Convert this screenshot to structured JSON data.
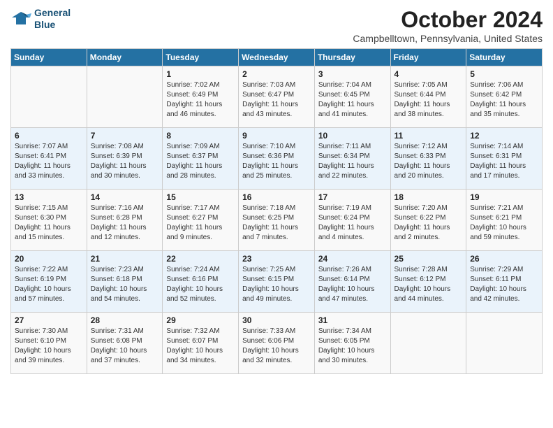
{
  "logo": {
    "line1": "General",
    "line2": "Blue"
  },
  "title": "October 2024",
  "subtitle": "Campbelltown, Pennsylvania, United States",
  "days_of_week": [
    "Sunday",
    "Monday",
    "Tuesday",
    "Wednesday",
    "Thursday",
    "Friday",
    "Saturday"
  ],
  "weeks": [
    [
      {
        "day": "",
        "sunrise": "",
        "sunset": "",
        "daylight": ""
      },
      {
        "day": "",
        "sunrise": "",
        "sunset": "",
        "daylight": ""
      },
      {
        "day": "1",
        "sunrise": "Sunrise: 7:02 AM",
        "sunset": "Sunset: 6:49 PM",
        "daylight": "Daylight: 11 hours and 46 minutes."
      },
      {
        "day": "2",
        "sunrise": "Sunrise: 7:03 AM",
        "sunset": "Sunset: 6:47 PM",
        "daylight": "Daylight: 11 hours and 43 minutes."
      },
      {
        "day": "3",
        "sunrise": "Sunrise: 7:04 AM",
        "sunset": "Sunset: 6:45 PM",
        "daylight": "Daylight: 11 hours and 41 minutes."
      },
      {
        "day": "4",
        "sunrise": "Sunrise: 7:05 AM",
        "sunset": "Sunset: 6:44 PM",
        "daylight": "Daylight: 11 hours and 38 minutes."
      },
      {
        "day": "5",
        "sunrise": "Sunrise: 7:06 AM",
        "sunset": "Sunset: 6:42 PM",
        "daylight": "Daylight: 11 hours and 35 minutes."
      }
    ],
    [
      {
        "day": "6",
        "sunrise": "Sunrise: 7:07 AM",
        "sunset": "Sunset: 6:41 PM",
        "daylight": "Daylight: 11 hours and 33 minutes."
      },
      {
        "day": "7",
        "sunrise": "Sunrise: 7:08 AM",
        "sunset": "Sunset: 6:39 PM",
        "daylight": "Daylight: 11 hours and 30 minutes."
      },
      {
        "day": "8",
        "sunrise": "Sunrise: 7:09 AM",
        "sunset": "Sunset: 6:37 PM",
        "daylight": "Daylight: 11 hours and 28 minutes."
      },
      {
        "day": "9",
        "sunrise": "Sunrise: 7:10 AM",
        "sunset": "Sunset: 6:36 PM",
        "daylight": "Daylight: 11 hours and 25 minutes."
      },
      {
        "day": "10",
        "sunrise": "Sunrise: 7:11 AM",
        "sunset": "Sunset: 6:34 PM",
        "daylight": "Daylight: 11 hours and 22 minutes."
      },
      {
        "day": "11",
        "sunrise": "Sunrise: 7:12 AM",
        "sunset": "Sunset: 6:33 PM",
        "daylight": "Daylight: 11 hours and 20 minutes."
      },
      {
        "day": "12",
        "sunrise": "Sunrise: 7:14 AM",
        "sunset": "Sunset: 6:31 PM",
        "daylight": "Daylight: 11 hours and 17 minutes."
      }
    ],
    [
      {
        "day": "13",
        "sunrise": "Sunrise: 7:15 AM",
        "sunset": "Sunset: 6:30 PM",
        "daylight": "Daylight: 11 hours and 15 minutes."
      },
      {
        "day": "14",
        "sunrise": "Sunrise: 7:16 AM",
        "sunset": "Sunset: 6:28 PM",
        "daylight": "Daylight: 11 hours and 12 minutes."
      },
      {
        "day": "15",
        "sunrise": "Sunrise: 7:17 AM",
        "sunset": "Sunset: 6:27 PM",
        "daylight": "Daylight: 11 hours and 9 minutes."
      },
      {
        "day": "16",
        "sunrise": "Sunrise: 7:18 AM",
        "sunset": "Sunset: 6:25 PM",
        "daylight": "Daylight: 11 hours and 7 minutes."
      },
      {
        "day": "17",
        "sunrise": "Sunrise: 7:19 AM",
        "sunset": "Sunset: 6:24 PM",
        "daylight": "Daylight: 11 hours and 4 minutes."
      },
      {
        "day": "18",
        "sunrise": "Sunrise: 7:20 AM",
        "sunset": "Sunset: 6:22 PM",
        "daylight": "Daylight: 11 hours and 2 minutes."
      },
      {
        "day": "19",
        "sunrise": "Sunrise: 7:21 AM",
        "sunset": "Sunset: 6:21 PM",
        "daylight": "Daylight: 10 hours and 59 minutes."
      }
    ],
    [
      {
        "day": "20",
        "sunrise": "Sunrise: 7:22 AM",
        "sunset": "Sunset: 6:19 PM",
        "daylight": "Daylight: 10 hours and 57 minutes."
      },
      {
        "day": "21",
        "sunrise": "Sunrise: 7:23 AM",
        "sunset": "Sunset: 6:18 PM",
        "daylight": "Daylight: 10 hours and 54 minutes."
      },
      {
        "day": "22",
        "sunrise": "Sunrise: 7:24 AM",
        "sunset": "Sunset: 6:16 PM",
        "daylight": "Daylight: 10 hours and 52 minutes."
      },
      {
        "day": "23",
        "sunrise": "Sunrise: 7:25 AM",
        "sunset": "Sunset: 6:15 PM",
        "daylight": "Daylight: 10 hours and 49 minutes."
      },
      {
        "day": "24",
        "sunrise": "Sunrise: 7:26 AM",
        "sunset": "Sunset: 6:14 PM",
        "daylight": "Daylight: 10 hours and 47 minutes."
      },
      {
        "day": "25",
        "sunrise": "Sunrise: 7:28 AM",
        "sunset": "Sunset: 6:12 PM",
        "daylight": "Daylight: 10 hours and 44 minutes."
      },
      {
        "day": "26",
        "sunrise": "Sunrise: 7:29 AM",
        "sunset": "Sunset: 6:11 PM",
        "daylight": "Daylight: 10 hours and 42 minutes."
      }
    ],
    [
      {
        "day": "27",
        "sunrise": "Sunrise: 7:30 AM",
        "sunset": "Sunset: 6:10 PM",
        "daylight": "Daylight: 10 hours and 39 minutes."
      },
      {
        "day": "28",
        "sunrise": "Sunrise: 7:31 AM",
        "sunset": "Sunset: 6:08 PM",
        "daylight": "Daylight: 10 hours and 37 minutes."
      },
      {
        "day": "29",
        "sunrise": "Sunrise: 7:32 AM",
        "sunset": "Sunset: 6:07 PM",
        "daylight": "Daylight: 10 hours and 34 minutes."
      },
      {
        "day": "30",
        "sunrise": "Sunrise: 7:33 AM",
        "sunset": "Sunset: 6:06 PM",
        "daylight": "Daylight: 10 hours and 32 minutes."
      },
      {
        "day": "31",
        "sunrise": "Sunrise: 7:34 AM",
        "sunset": "Sunset: 6:05 PM",
        "daylight": "Daylight: 10 hours and 30 minutes."
      },
      {
        "day": "",
        "sunrise": "",
        "sunset": "",
        "daylight": ""
      },
      {
        "day": "",
        "sunrise": "",
        "sunset": "",
        "daylight": ""
      }
    ]
  ]
}
